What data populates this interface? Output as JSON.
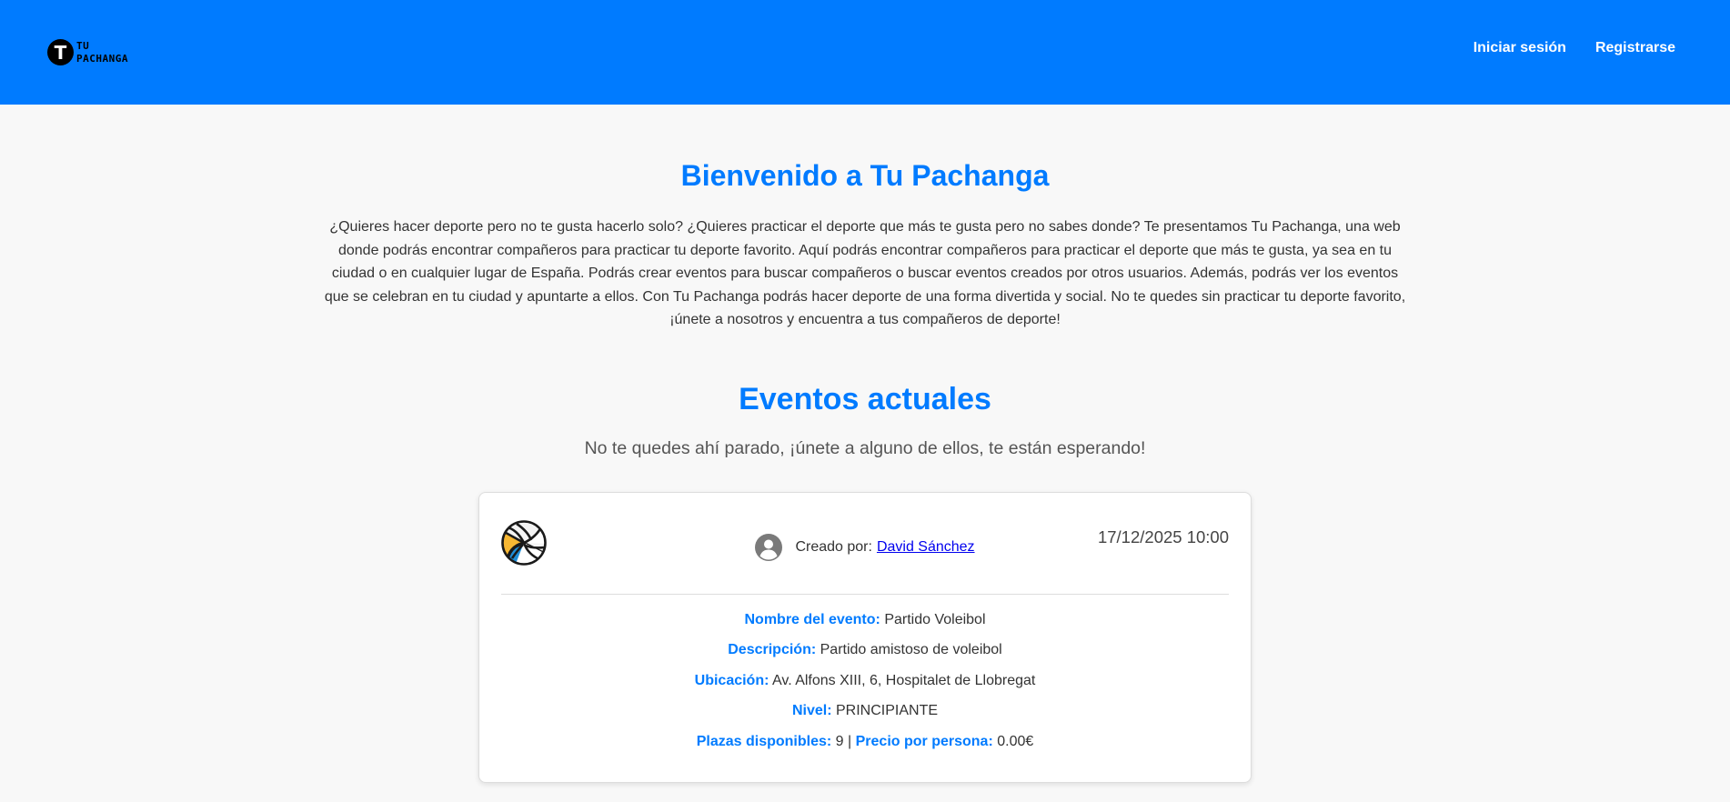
{
  "header": {
    "logo_letter": "T",
    "logo_line1": "TU",
    "logo_line2": "PACHANGA",
    "login_label": "Iniciar sesión",
    "register_label": "Registrarse",
    "bg_color": "#007bff"
  },
  "welcome": {
    "title": "Bienvenido a Tu Pachanga",
    "intro": "¿Quieres hacer deporte pero no te gusta hacerlo solo? ¿Quieres practicar el deporte que más te gusta pero no sabes donde? Te presentamos Tu Pachanga, una web donde podrás encontrar compañeros para practicar tu deporte favorito. Aquí podrás encontrar compañeros para practicar el deporte que más te gusta, ya sea en tu ciudad o en cualquier lugar de España. Podrás crear eventos para buscar compañeros o buscar eventos creados por otros usuarios. Además, podrás ver los eventos que se celebran en tu ciudad y apuntarte a ellos. Con Tu Pachanga podrás hacer deporte de una forma divertida y social. No te quedes sin practicar tu deporte favorito, ¡únete a nosotros y encuentra a tus compañeros de deporte!"
  },
  "events": {
    "title": "Eventos actuales",
    "subtitle": "No te quedes ahí parado, ¡únete a alguno de ellos, te están esperando!",
    "items": [
      {
        "sport_icon": "volleyball-icon",
        "creator_prefix": "Creado por:",
        "creator_name": "David Sánchez",
        "datetime": "17/12/2025 10:00",
        "name_label": "Nombre del evento:",
        "name_value": "Partido Voleibol",
        "description_label": "Descripción:",
        "description_value": "Partido amistoso de voleibol",
        "location_label": "Ubicación:",
        "location_value": "Av. Alfons XIII, 6, Hospitalet de Llobregat",
        "level_label": "Nivel:",
        "level_value": "PRINCIPIANTE",
        "slots_label": "Plazas disponibles:",
        "slots_value": "9",
        "separator": "|",
        "price_label": "Precio por persona:",
        "price_value": "0.00€"
      }
    ]
  },
  "colors": {
    "accent": "#007bff",
    "background": "#f8f8f8",
    "link": "#0000ee"
  }
}
